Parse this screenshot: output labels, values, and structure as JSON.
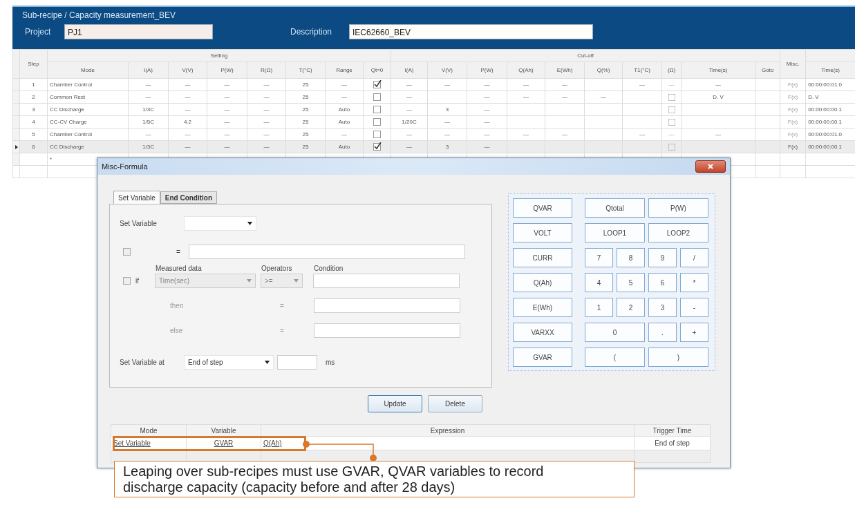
{
  "window": {
    "title": "Sub-recipe / Capacity measurement_BEV"
  },
  "project": {
    "label": "Project",
    "value": "PJ1"
  },
  "description": {
    "label": "Description",
    "value": "IEC62660_BEV"
  },
  "table": {
    "step_header": "Step",
    "groups": [
      "Setting",
      "Cut-off"
    ],
    "misc_header": "Misc.",
    "setting_columns": [
      "Mode",
      "I(A)",
      "V(V)",
      "P(W)",
      "R(Ω)",
      "T(°C)",
      "Range",
      "Qt=0"
    ],
    "cutoff_columns": [
      "I(A)",
      "V(V)",
      "P(W)",
      "Q(Ah)",
      "E(Wh)",
      "Q(%)",
      "T1(°C)",
      "(Ω)",
      "Time(s)",
      "Goto"
    ],
    "time_header": "Time(s)",
    "rows": [
      {
        "step": "1",
        "selected": false,
        "setting": [
          "Chamber Control",
          "—",
          "—",
          "—",
          "—",
          "25",
          "—"
        ],
        "qt0": true,
        "cutoff": [
          {
            "kind": "text",
            "text": "—"
          },
          {
            "kind": "text",
            "text": "—"
          },
          {
            "kind": "text",
            "text": "—"
          },
          {
            "kind": "text",
            "text": "—"
          },
          {
            "kind": "text",
            "text": "—"
          },
          {
            "kind": "empty"
          },
          {
            "kind": "text",
            "text": "—"
          },
          {
            "kind": "faint",
            "text": "—"
          },
          {
            "kind": "text",
            "text": "—"
          },
          {
            "kind": "empty"
          }
        ],
        "misc": {
          "text": "F(x)",
          "active": false
        },
        "time": "00:00:00:01.0"
      },
      {
        "step": "2",
        "selected": false,
        "setting": [
          "Common Rest",
          "—",
          "—",
          "—",
          "—",
          "25",
          "—"
        ],
        "qt0": false,
        "cutoff": [
          {
            "kind": "text",
            "text": "—"
          },
          {
            "kind": "empty"
          },
          {
            "kind": "text",
            "text": "—"
          },
          {
            "kind": "text",
            "text": "—"
          },
          {
            "kind": "text",
            "text": "—"
          },
          {
            "kind": "text",
            "text": "—"
          },
          {
            "kind": "empty"
          },
          {
            "kind": "box"
          },
          {
            "kind": "text",
            "text": "D. V"
          },
          {
            "kind": "empty"
          }
        ],
        "misc": {
          "text": "F(x)",
          "active": false
        },
        "time": "D. V"
      },
      {
        "step": "3",
        "selected": false,
        "setting": [
          "CC Discharge",
          "1/3C",
          "—",
          "—",
          "—",
          "25",
          "Auto"
        ],
        "qt0": false,
        "cutoff": [
          {
            "kind": "text",
            "text": "—"
          },
          {
            "kind": "text",
            "text": "3"
          },
          {
            "kind": "text",
            "text": "—"
          },
          {
            "kind": "empty"
          },
          {
            "kind": "empty"
          },
          {
            "kind": "empty"
          },
          {
            "kind": "empty"
          },
          {
            "kind": "box"
          },
          {
            "kind": "empty"
          },
          {
            "kind": "empty"
          }
        ],
        "misc": {
          "text": "F(x)",
          "active": false
        },
        "time": "00:00:00:00.1"
      },
      {
        "step": "4",
        "selected": false,
        "setting": [
          "CC-CV Charge",
          "1/5C",
          "4.2",
          "—",
          "—",
          "25",
          "Auto"
        ],
        "qt0": false,
        "cutoff": [
          {
            "kind": "text",
            "text": "1/20C"
          },
          {
            "kind": "text",
            "text": "—"
          },
          {
            "kind": "text",
            "text": "—"
          },
          {
            "kind": "empty"
          },
          {
            "kind": "empty"
          },
          {
            "kind": "empty"
          },
          {
            "kind": "empty"
          },
          {
            "kind": "box"
          },
          {
            "kind": "empty"
          },
          {
            "kind": "empty"
          }
        ],
        "misc": {
          "text": "F(x)",
          "active": false
        },
        "time": "00:00:00:00.1"
      },
      {
        "step": "5",
        "selected": false,
        "setting": [
          "Chamber Control",
          "—",
          "—",
          "—",
          "—",
          "25",
          "—"
        ],
        "qt0": false,
        "cutoff": [
          {
            "kind": "text",
            "text": "—"
          },
          {
            "kind": "text",
            "text": "—"
          },
          {
            "kind": "text",
            "text": "—"
          },
          {
            "kind": "text",
            "text": "—"
          },
          {
            "kind": "text",
            "text": "—"
          },
          {
            "kind": "empty"
          },
          {
            "kind": "text",
            "text": "—"
          },
          {
            "kind": "faint",
            "text": "—"
          },
          {
            "kind": "text",
            "text": "—"
          },
          {
            "kind": "empty"
          }
        ],
        "misc": {
          "text": "F(x)",
          "active": false
        },
        "time": "00:00:00:01.0"
      },
      {
        "step": "6",
        "selected": true,
        "setting": [
          "CC Discharge",
          "1/3C",
          "—",
          "—",
          "—",
          "25",
          "Auto"
        ],
        "qt0": true,
        "cutoff": [
          {
            "kind": "text",
            "text": "—"
          },
          {
            "kind": "text",
            "text": "3"
          },
          {
            "kind": "text",
            "text": "—"
          },
          {
            "kind": "empty"
          },
          {
            "kind": "empty"
          },
          {
            "kind": "empty"
          },
          {
            "kind": "empty"
          },
          {
            "kind": "box"
          },
          {
            "kind": "empty"
          },
          {
            "kind": "empty"
          }
        ],
        "misc": {
          "text": "F(x)",
          "active": true
        },
        "time": "00:00:00:00.1"
      }
    ],
    "new_row_marker": "*"
  },
  "dialog": {
    "title": "Misc-Formula",
    "tabs": [
      {
        "label": "Set Variable",
        "selected": true
      },
      {
        "label": "End Condition",
        "selected": false
      }
    ],
    "set_variable": {
      "label": "Set Variable"
    },
    "assign_row": {
      "checked": false,
      "operator": "="
    },
    "if_row": {
      "checked": false,
      "disabled": true,
      "keyword": "if",
      "measured_label": "Measured data",
      "measured_value": "Time(sec)",
      "operators_label": "Operators",
      "operator_value": ">=",
      "condition_label": "Condition"
    },
    "then_row": {
      "label": "then",
      "operator": "="
    },
    "else_row": {
      "label": "else",
      "operator": "="
    },
    "set_at": {
      "label": "Set Variable at",
      "value": "End of step",
      "unit": "ms"
    },
    "keypad": [
      [
        {
          "label": "QVAR",
          "kind": "variable"
        },
        {
          "label": "Qtotal",
          "kind": "double"
        },
        {
          "label": "P(W)",
          "kind": "double"
        }
      ],
      [
        {
          "label": "VOLT",
          "kind": "variable"
        },
        {
          "label": "LOOP1",
          "kind": "double"
        },
        {
          "label": "LOOP2",
          "kind": "double"
        }
      ],
      [
        {
          "label": "CURR",
          "kind": "variable"
        },
        {
          "label": "7",
          "kind": "digit"
        },
        {
          "label": "8",
          "kind": "digit"
        },
        {
          "label": "9",
          "kind": "digit"
        },
        {
          "label": "/",
          "kind": "digit"
        }
      ],
      [
        {
          "label": "Q(Ah)",
          "kind": "variable"
        },
        {
          "label": "4",
          "kind": "digit"
        },
        {
          "label": "5",
          "kind": "digit"
        },
        {
          "label": "6",
          "kind": "digit"
        },
        {
          "label": "*",
          "kind": "digit"
        }
      ],
      [
        {
          "label": "E(Wh)",
          "kind": "variable"
        },
        {
          "label": "1",
          "kind": "digit"
        },
        {
          "label": "2",
          "kind": "digit"
        },
        {
          "label": "3",
          "kind": "digit"
        },
        {
          "label": "-",
          "kind": "digit"
        }
      ],
      [
        {
          "label": "VARXX",
          "kind": "variable"
        },
        {
          "label": "0",
          "kind": "double"
        },
        {
          "label": ".",
          "kind": "digit"
        },
        {
          "label": "+",
          "kind": "digit"
        }
      ],
      [
        {
          "label": "GVAR",
          "kind": "variable"
        },
        {
          "label": "(",
          "kind": "double"
        },
        {
          "label": ")",
          "kind": "double"
        }
      ]
    ],
    "buttons": [
      "Update",
      "Delete"
    ],
    "grid": {
      "columns": [
        "Mode",
        "Variable",
        "Expression",
        "Trigger Time"
      ],
      "rows": [
        {
          "cells": [
            "Set Variable",
            "GVAR",
            "Q(Ah)",
            "End of step"
          ],
          "highlighted": true
        }
      ]
    }
  },
  "callout": {
    "text": "Leaping over sub-recipes must use GVAR, QVAR variables to record discharge capacity (capacity before and after 28 days)"
  }
}
